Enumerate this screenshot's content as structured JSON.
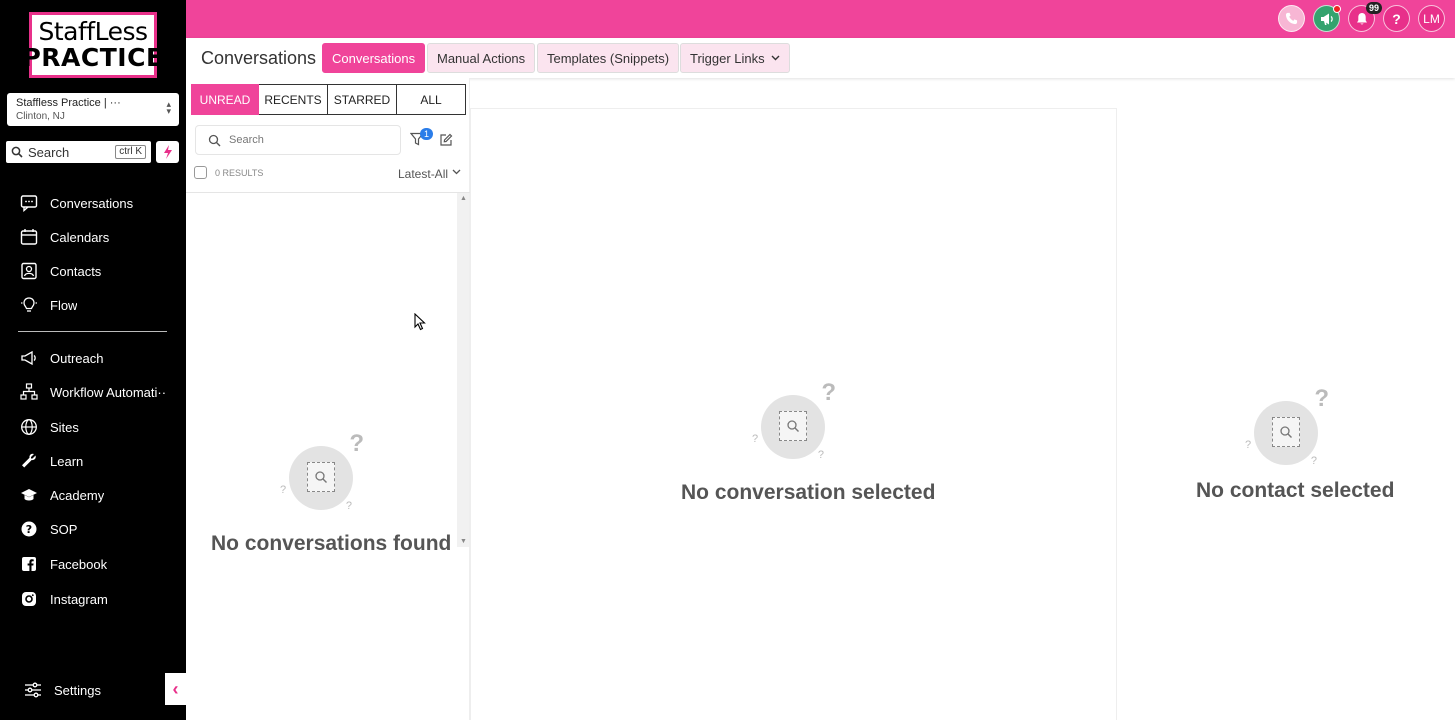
{
  "brand": {
    "logo_line1": "StaffLess",
    "logo_line2": "PRACTICE",
    "accent": "#f0449a",
    "sidebar_bg": "#000000"
  },
  "location": {
    "name": "Staffless Practice | ···",
    "city": "Clinton, NJ"
  },
  "sidebar_search": {
    "placeholder": "Search",
    "shortcut": "ctrl K"
  },
  "nav": {
    "top": [
      {
        "label": "Conversations",
        "icon": "chat-icon"
      },
      {
        "label": "Calendars",
        "icon": "calendar-icon"
      },
      {
        "label": "Contacts",
        "icon": "contacts-icon"
      },
      {
        "label": "Flow",
        "icon": "lightbulb-icon"
      }
    ],
    "bottom": [
      {
        "label": "Outreach",
        "icon": "megaphone-icon"
      },
      {
        "label": "Workflow Automati···",
        "icon": "workflow-icon"
      },
      {
        "label": "Sites",
        "icon": "globe-icon"
      },
      {
        "label": "Learn",
        "icon": "wrench-icon"
      },
      {
        "label": "Academy",
        "icon": "graduation-cap-icon"
      },
      {
        "label": "SOP",
        "icon": "help-circle-icon"
      },
      {
        "label": "Facebook",
        "icon": "facebook-icon"
      },
      {
        "label": "Instagram",
        "icon": "instagram-icon"
      }
    ],
    "settings": "Settings"
  },
  "topbar": {
    "notifications_count": "99",
    "avatar_initials": "LM",
    "help_label": "?"
  },
  "header": {
    "title": "Conversations",
    "tabs": [
      {
        "label": "Conversations",
        "active": true
      },
      {
        "label": "Manual Actions"
      },
      {
        "label": "Templates (Snippets)"
      },
      {
        "label": "Trigger Links"
      }
    ]
  },
  "list": {
    "filters": [
      "UNREAD",
      "RECENTS",
      "STARRED",
      "ALL"
    ],
    "search_placeholder": "Search",
    "filter_badge": "1",
    "results": "0 RESULTS",
    "sort": "Latest-All",
    "empty": "No conversations found"
  },
  "conversation": {
    "empty": "No conversation selected"
  },
  "contact": {
    "empty": "No contact selected"
  }
}
